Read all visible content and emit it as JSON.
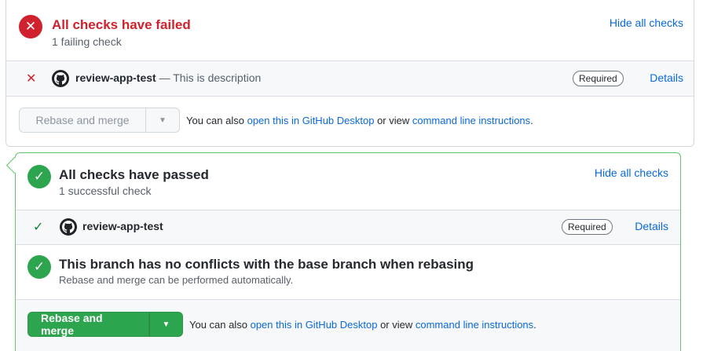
{
  "failed_panel": {
    "status_icon": "x-icon",
    "title": "All checks have failed",
    "subtitle": "1 failing check",
    "toggle_link": "Hide all checks",
    "check": {
      "status_icon": "x-icon",
      "app_icon": "github-icon",
      "name": "review-app-test",
      "description": "— This is description",
      "badge": "Required",
      "details_link": "Details"
    },
    "merge": {
      "button_label": "Rebase and merge",
      "caret_icon": "caret-down-icon",
      "info_prefix": "You can also ",
      "desktop_link": "open this in GitHub Desktop",
      "info_middle": " or view ",
      "cli_link": "command line instructions",
      "info_suffix": "."
    }
  },
  "passed_panel": {
    "status_icon": "check-icon",
    "title": "All checks have passed",
    "subtitle": "1 successful check",
    "toggle_link": "Hide all checks",
    "check": {
      "status_icon": "check-icon",
      "app_icon": "github-icon",
      "name": "review-app-test",
      "badge": "Required",
      "details_link": "Details"
    },
    "conflicts": {
      "status_icon": "check-icon",
      "title": "This branch has no conflicts with the base branch when rebasing",
      "subtitle": "Rebase and merge can be performed automatically."
    },
    "merge": {
      "button_label": "Rebase and merge",
      "caret_icon": "caret-down-icon",
      "info_prefix": "You can also ",
      "desktop_link": "open this in GitHub Desktop",
      "info_middle": " or view ",
      "cli_link": "command line instructions",
      "info_suffix": "."
    }
  },
  "colors": {
    "fail": "#cf222e",
    "success": "#2da44e",
    "link": "#0969da",
    "border_success": "#5fc76e"
  }
}
